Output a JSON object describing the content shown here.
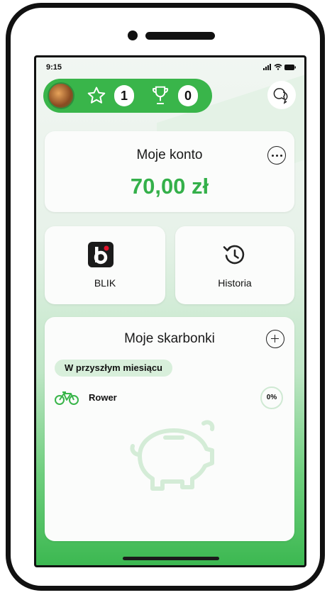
{
  "status_bar": {
    "time": "9:15"
  },
  "header": {
    "stars_count": "1",
    "trophies_count": "0"
  },
  "account": {
    "title": "Moje konto",
    "balance": "70,00 zł"
  },
  "tiles": {
    "blik_label": "BLIK",
    "history_label": "Historia"
  },
  "piggybanks": {
    "title": "Moje skarbonki",
    "section_label": "W przyszłym miesiącu",
    "goals": [
      {
        "name": "Rower",
        "progress": "0%"
      }
    ]
  },
  "colors": {
    "accent": "#39b54a",
    "amount": "#34b04a"
  }
}
